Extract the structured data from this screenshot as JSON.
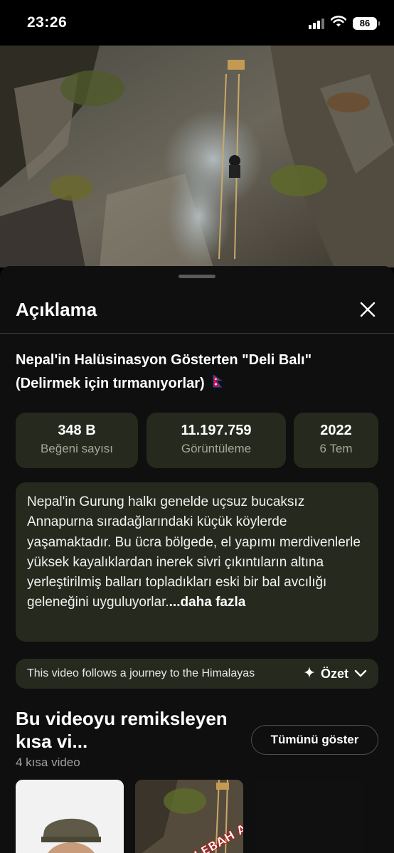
{
  "status_bar": {
    "time": "23:26",
    "battery": "86"
  },
  "sheet": {
    "title": "Açıklama"
  },
  "video": {
    "title": "Nepal'in Halüsinasyon Gösterten \"Deli Balı\" (Delirmek için tırmanıyorlar)",
    "stats": [
      {
        "value": "348 B",
        "label": "Beğeni sayısı"
      },
      {
        "value": "11.197.759",
        "label": "Görüntüleme"
      },
      {
        "value": "2022",
        "label": "6 Tem"
      }
    ],
    "description": "Nepal'in Gurung halkı genelde uçsuz bucaksız Annapurna sıradağlarındaki küçük köylerde yaşamaktadır. Bu ücra bölgede, el yapımı merdivenlerle yüksek kayalıklardan inerek sivri çıkıntıların altına yerleştirilmiş balları topladıkları eski bir bal avcılığı geleneğini uyguluyorlar.",
    "more_label": "...daha fazla"
  },
  "ai_summary": {
    "text": "This video follows a journey to the Himalayas",
    "button_label": "Özet"
  },
  "shorts": {
    "title": "Bu videoyu remiksleyen kısa vi...",
    "count": "4 kısa video",
    "show_all": "Tümünü göster",
    "thumb_overlay": "EPUL LEBAH AR BIASA"
  },
  "colors": {
    "card": "#262a1e",
    "sheet": "#0f0f0f",
    "muted": "#a5a79a"
  },
  "icons": [
    "signal-icon",
    "wifi-icon",
    "battery-icon",
    "close-icon",
    "nepal-flag-icon",
    "sparkle-icon",
    "chevron-down-icon"
  ]
}
